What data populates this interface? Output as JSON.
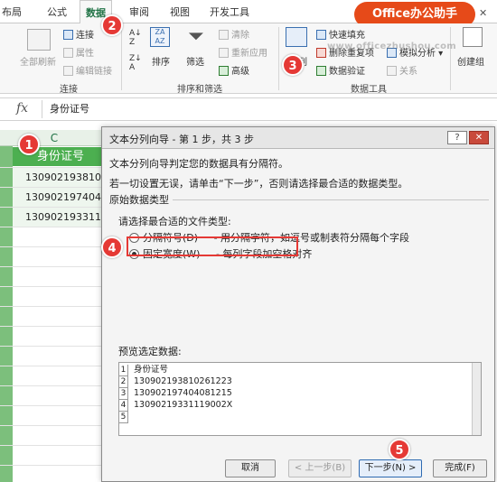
{
  "tabs": [
    "布局",
    "公式",
    "数据",
    "审阅",
    "视图",
    "开发工具"
  ],
  "active_tab": "数据",
  "logo_text": "Office办公助手",
  "watermark": "www.officezhushou.com",
  "ribbon": {
    "connections": {
      "refresh_all": "全部刷新",
      "connections": "连接",
      "properties": "属性",
      "edit_links": "编辑链接",
      "group_label": "连接"
    },
    "sort_filter": {
      "sort": "排序",
      "filter": "筛选",
      "clear": "清除",
      "reapply": "重新应用",
      "advanced": "高级",
      "group_label": "排序和筛选"
    },
    "data_tools": {
      "text_to_columns": "列",
      "flash_fill": "快速填充",
      "remove_duplicates": "删除重复项",
      "data_validation": "数据验证",
      "what_if": "模拟分析",
      "relationships": "关系",
      "group_label": "数据工具"
    },
    "outline": {
      "group": "创建组"
    }
  },
  "formula_bar": {
    "fx": "fx",
    "value": "身份证号"
  },
  "sheet": {
    "column_header": "C",
    "cells": [
      "身份证号",
      "130902193810226",
      "130902197404081",
      "130902193311190"
    ]
  },
  "dialog": {
    "title": "文本分列向导 - 第 1 步，共 3 步",
    "help": "?",
    "close": "✕",
    "line1": "文本分列向导判定您的数据具有分隔符。",
    "line2": "若一切设置无误，请单击“下一步”，否则请选择最合适的数据类型。",
    "legend": "原始数据类型",
    "prompt": "请选择最合适的文件类型:",
    "option_delimited": "分隔符号(D)",
    "option_delimited_desc": "- 用分隔字符，如逗号或制表符分隔每个字段",
    "option_fixed": "固定宽度(W)",
    "option_fixed_desc": "- 每列字段加空格对齐",
    "preview_label": "预览选定数据:",
    "preview_rows": [
      {
        "num": "1",
        "text": "身份证号"
      },
      {
        "num": "2",
        "text": "130902193810261223"
      },
      {
        "num": "3",
        "text": "130902197404081215"
      },
      {
        "num": "4",
        "text": "13090219331119002X"
      },
      {
        "num": "5",
        "text": ""
      }
    ],
    "btn_cancel": "取消",
    "btn_back": "< 上一步(B)",
    "btn_next": "下一步(N) >",
    "btn_finish": "完成(F)"
  },
  "badges": [
    "1",
    "2",
    "3",
    "4",
    "5"
  ]
}
